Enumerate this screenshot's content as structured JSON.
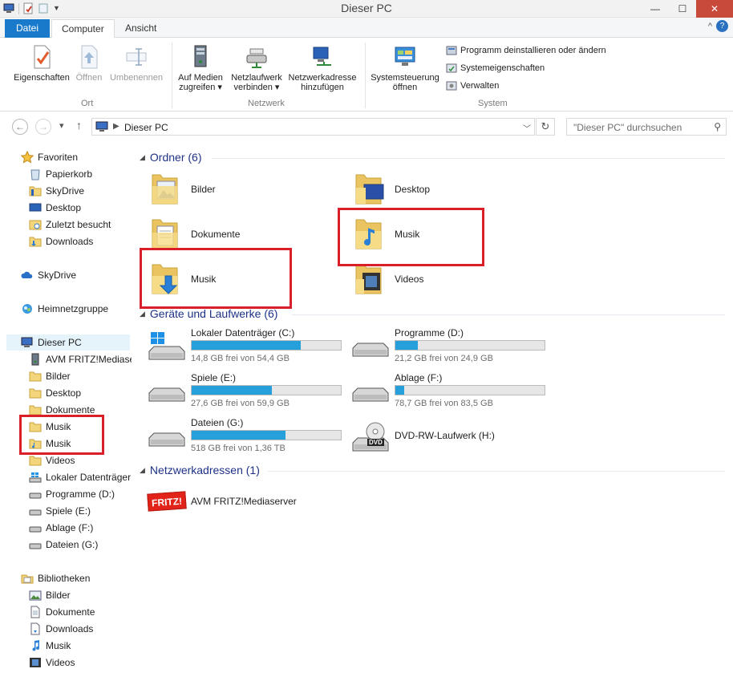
{
  "window": {
    "title": "Dieser PC"
  },
  "ribbon_tabs": [
    {
      "label": "Datei"
    },
    {
      "label": "Computer"
    },
    {
      "label": "Ansicht"
    }
  ],
  "ribbon": {
    "groups": {
      "ort": "Ort",
      "netzwerk": "Netzwerk",
      "system": "System"
    },
    "buttons": {
      "eigenschaften": "Eigenschaften",
      "oeffnen": "Öffnen",
      "umbenennen": "Umbenennen",
      "auf_medien_1": "Auf Medien",
      "auf_medien_2": "zugreifen",
      "netzlaufwerk_1": "Netzlaufwerk",
      "netzlaufwerk_2": "verbinden",
      "netzwerkadresse_1": "Netzwerkadresse",
      "netzwerkadresse_2": "hinzufügen",
      "systemsteuerung_1": "Systemsteuerung",
      "systemsteuerung_2": "öffnen"
    },
    "system_items": [
      "Programm deinstallieren oder ändern",
      "Systemeigenschaften",
      "Verwalten"
    ]
  },
  "address": {
    "path": "Dieser PC",
    "search_placeholder": "\"Dieser PC\" durchsuchen"
  },
  "nav": {
    "favoriten": "Favoriten",
    "favoriten_items": [
      "Papierkorb",
      "SkyDrive",
      "Desktop",
      "Zuletzt besucht",
      "Downloads"
    ],
    "skydrive": "SkyDrive",
    "heimnetzgruppe": "Heimnetzgruppe",
    "dieser_pc": "Dieser PC",
    "pc_items": [
      "AVM FRITZ!Mediase",
      "Bilder",
      "Desktop",
      "Dokumente",
      "Musik",
      "Musik",
      "Videos",
      "Lokaler Datenträger",
      "Programme (D:)",
      "Spiele (E:)",
      "Ablage (F:)",
      "Dateien (G:)"
    ],
    "bibliotheken": "Bibliotheken",
    "lib_items": [
      "Bilder",
      "Dokumente",
      "Downloads",
      "Musik",
      "Videos"
    ]
  },
  "content": {
    "ordner_header": "Ordner (6)",
    "folders": [
      {
        "name": "Bilder"
      },
      {
        "name": "Desktop"
      },
      {
        "name": "Dokumente"
      },
      {
        "name": "Musik"
      },
      {
        "name": "Musik"
      },
      {
        "name": "Videos"
      }
    ],
    "geraete_header": "Geräte und Laufwerke (6)",
    "drives": [
      {
        "name": "Lokaler Datenträger (C:)",
        "free": "14,8 GB frei von 54,4 GB",
        "used_fraction": 0.73
      },
      {
        "name": "Programme (D:)",
        "free": "21,2 GB frei von 24,9 GB",
        "used_fraction": 0.15
      },
      {
        "name": "Spiele (E:)",
        "free": "27,6 GB frei von 59,9 GB",
        "used_fraction": 0.54
      },
      {
        "name": "Ablage (F:)",
        "free": "78,7 GB frei von 83,5 GB",
        "used_fraction": 0.06
      },
      {
        "name": "Dateien (G:)",
        "free": "518 GB frei von 1,36 TB",
        "used_fraction": 0.63
      }
    ],
    "dvd": {
      "name": "DVD-RW-Laufwerk (H:)",
      "badge": "DVD"
    },
    "netz_header": "Netzwerkadressen (1)",
    "net_items": [
      {
        "name": "AVM FRITZ!Mediaserver",
        "logo": "FRITZ!"
      }
    ]
  },
  "colors": {
    "accent": "#1979ca",
    "drive_bar": "#26a0da",
    "highlight": "#d9202a",
    "folder": "#f3d57b"
  }
}
